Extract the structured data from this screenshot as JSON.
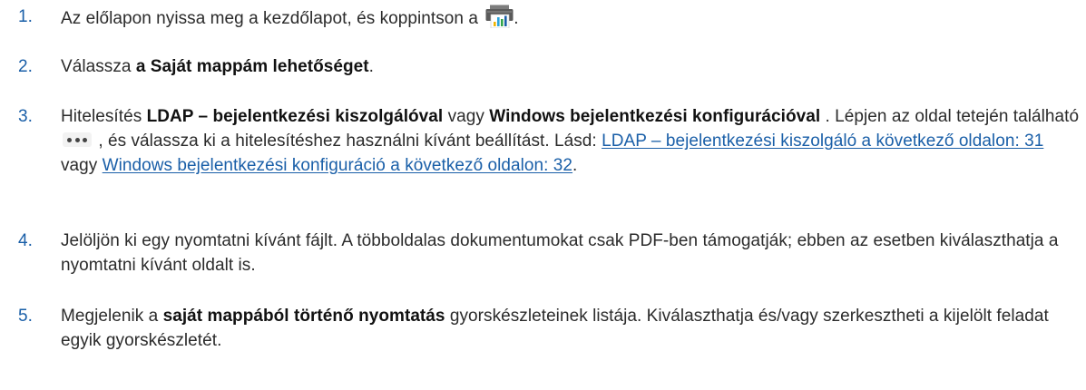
{
  "steps": [
    {
      "number": "1.",
      "text_before_icon": "Az előlapon nyissa meg a kezdőlapot, és koppintson a ",
      "icon": "printer-icon",
      "text_after_icon": "."
    },
    {
      "number": "2.",
      "text_1": "Válassza ",
      "bold_1": "a Saját mappám lehetőséget",
      "text_2": "."
    },
    {
      "number": "3.",
      "text_1": "Hitelesítés ",
      "bold_1": "LDAP – bejelentkezési kiszolgálóval",
      "text_2": " vagy ",
      "bold_2": "Windows bejelentkezési konfigurációval",
      "text_3": " . Lépjen az oldal tetején található ",
      "icon": "more-icon",
      "text_4": " , és válassza ki a hitelesítéshez használni kívánt beállítást. Lásd: ",
      "link_1": "LDAP – bejelentkezési kiszolgáló a következő oldalon: 31",
      "text_5": " vagy ",
      "link_2": "Windows bejelentkezési konfiguráció a következő oldalon: 32",
      "text_6": "."
    },
    {
      "number": "4.",
      "text": "Jelöljön ki egy nyomtatni kívánt fájlt. A többoldalas dokumentumokat csak PDF-ben támogatják; ebben az esetben kiválaszthatja a nyomtatni kívánt oldalt is."
    },
    {
      "number": "5.",
      "text_1": "Megjelenik a ",
      "bold_1": "saját mappából történő nyomtatás",
      "text_2": " gyorskészleteinek listája. Kiválaszthatja és/vagy szerkesztheti a kijelölt feladat egyik gyorskészletét."
    }
  ],
  "colors": {
    "number": "#1a5fa8",
    "link": "#1a5fa8",
    "text": "#2b2b2b"
  }
}
